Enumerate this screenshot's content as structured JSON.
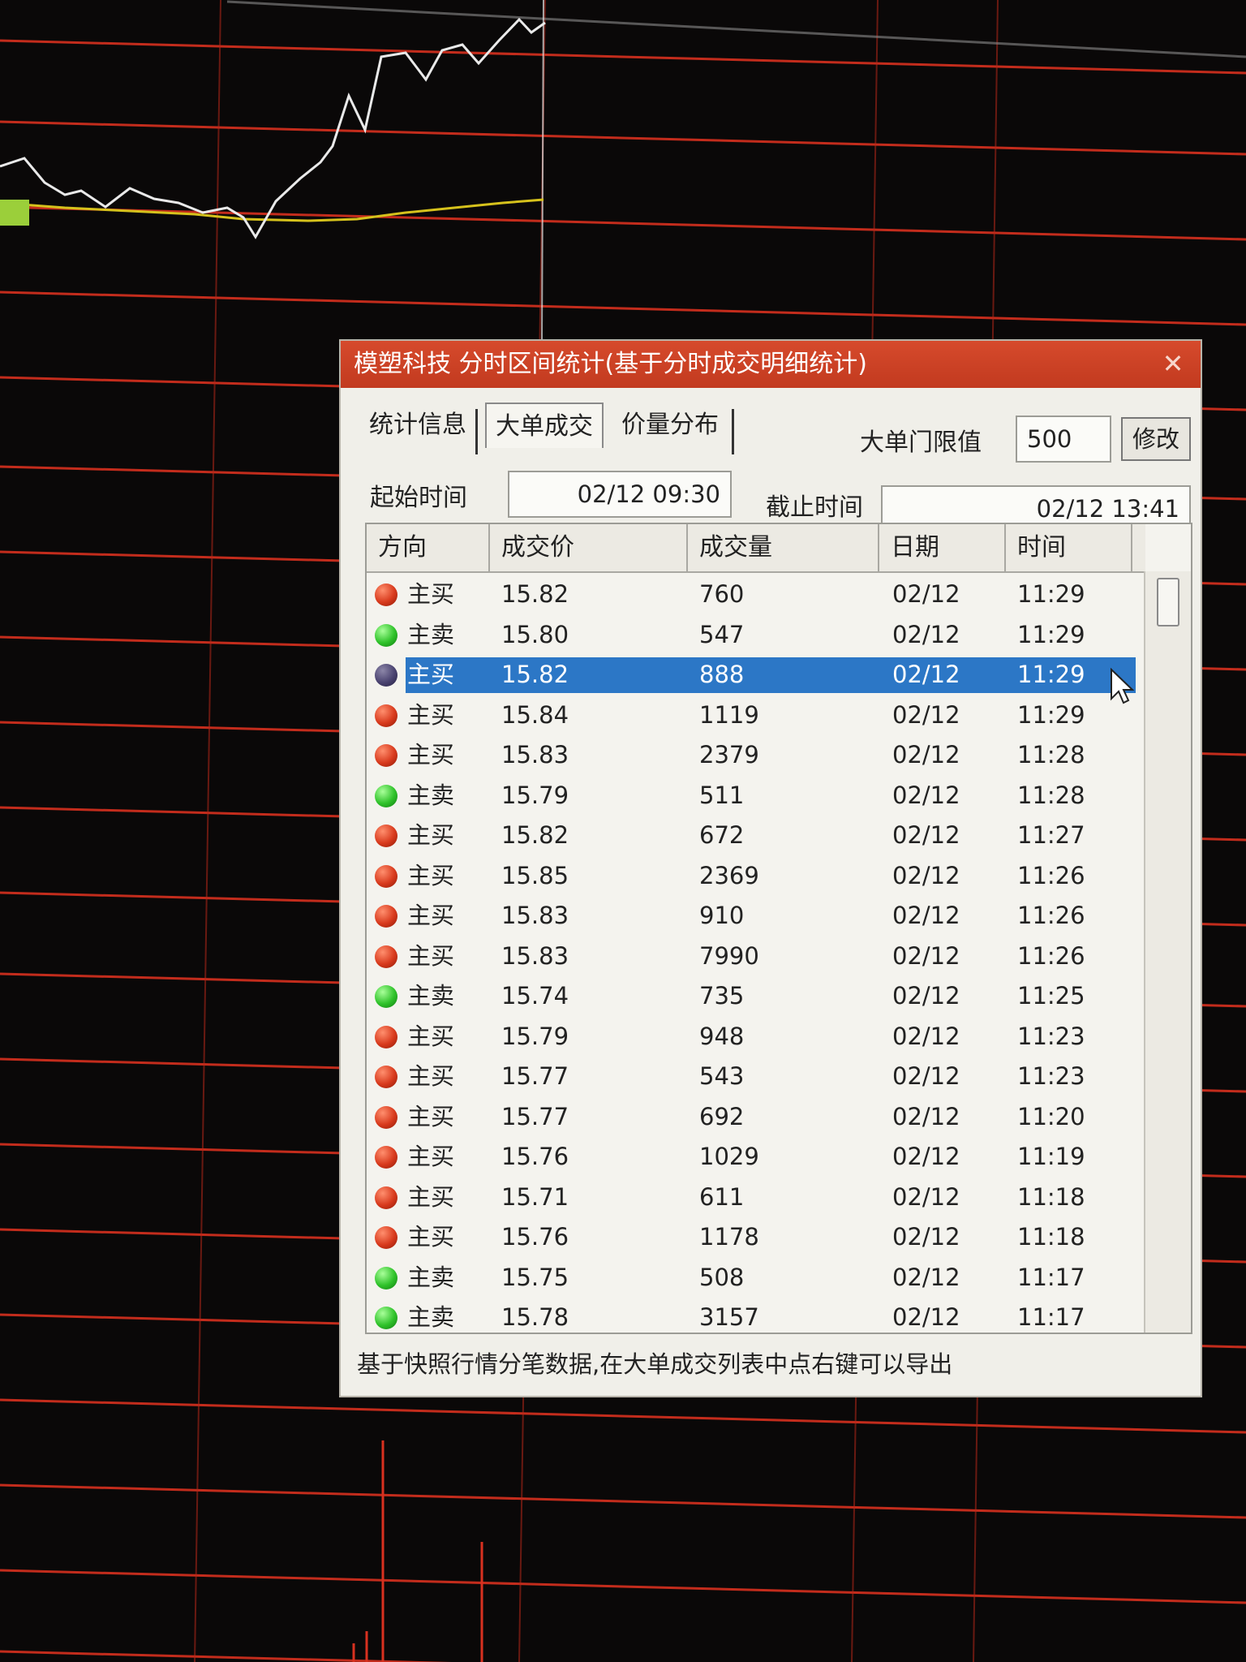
{
  "window": {
    "title": "模塑科技 分时区间统计(基于分时成交明细统计)",
    "close_glyph": "✕"
  },
  "tabs": [
    {
      "label": "统计信息",
      "active": false
    },
    {
      "label": "大单成交",
      "active": true
    },
    {
      "label": "价量分布",
      "active": false
    }
  ],
  "threshold": {
    "label": "大单门限值",
    "value": "500",
    "button": "修改"
  },
  "range": {
    "start_label": "起始时间",
    "start_value": "02/12 09:30",
    "end_label": "截止时间",
    "end_value": "02/12 13:41"
  },
  "table": {
    "headers": [
      "方向",
      "成交价",
      "成交量",
      "日期",
      "时间"
    ],
    "rows": [
      {
        "dir": "主买",
        "side": "buy",
        "price": "15.82",
        "vol": "760",
        "date": "02/12",
        "time": "11:29"
      },
      {
        "dir": "主卖",
        "side": "sell",
        "price": "15.80",
        "vol": "547",
        "date": "02/12",
        "time": "11:29"
      },
      {
        "dir": "主买",
        "side": "buy",
        "price": "15.82",
        "vol": "888",
        "date": "02/12",
        "time": "11:29",
        "selected": true
      },
      {
        "dir": "主买",
        "side": "buy",
        "price": "15.84",
        "vol": "1119",
        "date": "02/12",
        "time": "11:29"
      },
      {
        "dir": "主买",
        "side": "buy",
        "price": "15.83",
        "vol": "2379",
        "date": "02/12",
        "time": "11:28"
      },
      {
        "dir": "主卖",
        "side": "sell",
        "price": "15.79",
        "vol": "511",
        "date": "02/12",
        "time": "11:28"
      },
      {
        "dir": "主买",
        "side": "buy",
        "price": "15.82",
        "vol": "672",
        "date": "02/12",
        "time": "11:27"
      },
      {
        "dir": "主买",
        "side": "buy",
        "price": "15.85",
        "vol": "2369",
        "date": "02/12",
        "time": "11:26"
      },
      {
        "dir": "主买",
        "side": "buy",
        "price": "15.83",
        "vol": "910",
        "date": "02/12",
        "time": "11:26"
      },
      {
        "dir": "主买",
        "side": "buy",
        "price": "15.83",
        "vol": "7990",
        "date": "02/12",
        "time": "11:26"
      },
      {
        "dir": "主卖",
        "side": "sell",
        "price": "15.74",
        "vol": "735",
        "date": "02/12",
        "time": "11:25"
      },
      {
        "dir": "主买",
        "side": "buy",
        "price": "15.79",
        "vol": "948",
        "date": "02/12",
        "time": "11:23"
      },
      {
        "dir": "主买",
        "side": "buy",
        "price": "15.77",
        "vol": "543",
        "date": "02/12",
        "time": "11:23"
      },
      {
        "dir": "主买",
        "side": "buy",
        "price": "15.77",
        "vol": "692",
        "date": "02/12",
        "time": "11:20"
      },
      {
        "dir": "主买",
        "side": "buy",
        "price": "15.76",
        "vol": "1029",
        "date": "02/12",
        "time": "11:19"
      },
      {
        "dir": "主买",
        "side": "buy",
        "price": "15.71",
        "vol": "611",
        "date": "02/12",
        "time": "11:18"
      },
      {
        "dir": "主买",
        "side": "buy",
        "price": "15.76",
        "vol": "1178",
        "date": "02/12",
        "time": "11:18"
      },
      {
        "dir": "主卖",
        "side": "sell",
        "price": "15.75",
        "vol": "508",
        "date": "02/12",
        "time": "11:17"
      },
      {
        "dir": "主卖",
        "side": "sell",
        "price": "15.78",
        "vol": "3157",
        "date": "02/12",
        "time": "11:17"
      }
    ]
  },
  "footer": "基于快照行情分笔数据,在大单成交列表中点右键可以导出",
  "colors": {
    "grid_red": "#d8311f",
    "price_line": "#e9e9e9",
    "avg_line": "#d6c21c",
    "title_bar": "#c9401f",
    "selection": "#2c77c6"
  }
}
